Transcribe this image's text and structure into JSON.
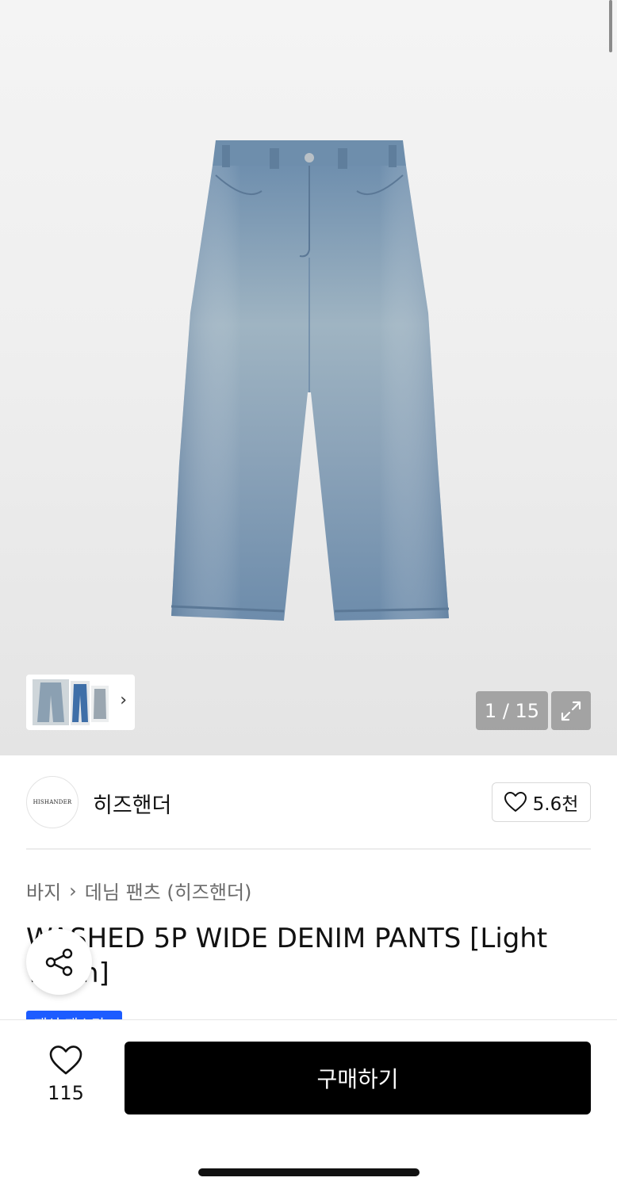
{
  "gallery": {
    "counter": "1 / 15",
    "product_image": "light-wash-wide-denim-pants"
  },
  "brand": {
    "logo_text": "HISHANDER",
    "name": "히즈핸더",
    "likes": "5.6천"
  },
  "breadcrumb": {
    "category": "바지",
    "subcategory": "데님 팬츠 (히즈핸더)"
  },
  "product": {
    "title": "WASHED 5P WIDE DENIM PANTS [Light Wash]",
    "badge": "패션 패스티"
  },
  "bottom_bar": {
    "wish_count": "115",
    "buy_label": "구매하기"
  },
  "colors": {
    "accent_blue": "#1d5cff",
    "buy_button": "#000000"
  }
}
